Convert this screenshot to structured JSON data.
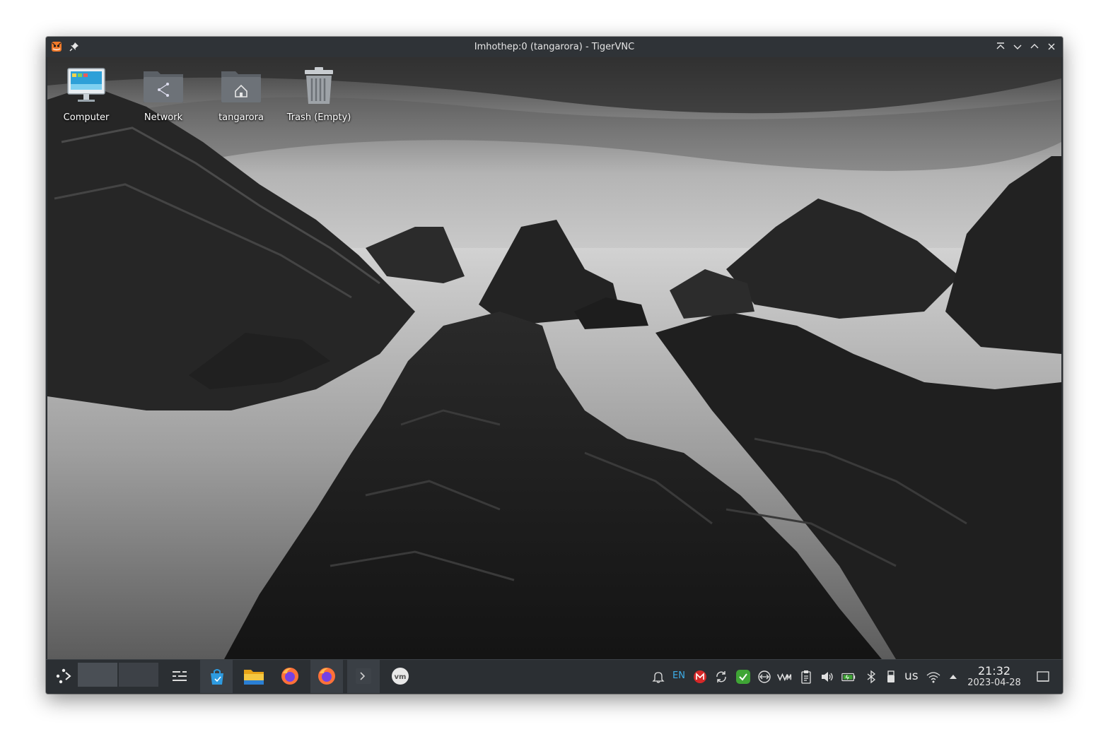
{
  "window": {
    "title": "Imhothep:0 (tangarora) - TigerVNC"
  },
  "desktop_icons": [
    {
      "label": "Computer",
      "icon": "computer-icon"
    },
    {
      "label": "Network",
      "icon": "network-folder-icon"
    },
    {
      "label": "tangarora",
      "icon": "home-folder-icon"
    },
    {
      "label": "Trash (Empty)",
      "icon": "trash-icon"
    }
  ],
  "taskbar": {
    "launcher_icon": "application-launcher-icon",
    "apps": [
      "overview-icon",
      "software-store-icon",
      "file-manager-icon",
      "firefox-icon",
      "firefox-icon",
      "terminal-icon",
      "vmware-icon"
    ],
    "tray": {
      "language": "EN",
      "keyboard_layout": "us",
      "time": "21:32",
      "date": "2023-04-28"
    }
  },
  "colors": {
    "titlebar": "#2f3337",
    "taskbar": "#2b2f33",
    "accent": "#3daee9"
  }
}
